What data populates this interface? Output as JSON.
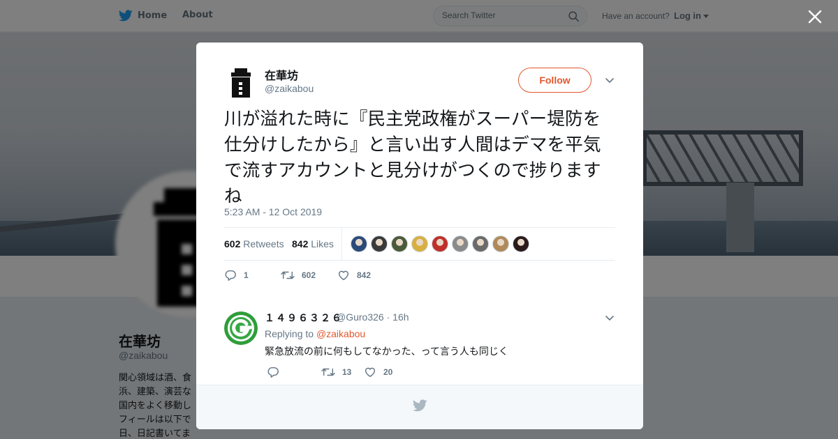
{
  "topbar": {
    "home_label": "Home",
    "about_label": "About",
    "search_placeholder": "Search Twitter",
    "account_prompt": "Have an account?",
    "login_label": "Log in"
  },
  "profile": {
    "name": "在華坊",
    "handle": "@zaikabou",
    "bio_lines": [
      "関心領域は酒、食",
      "浜、建築、演芸な",
      "国内をよく移動し",
      "フィールは以下で",
      "日、日記書いてま"
    ]
  },
  "tweet": {
    "author_name": "在華坊",
    "author_handle": "@zaikabou",
    "follow_label": "Follow",
    "text": "川が溢れた時に『民主党政権がスーパー堤防を仕分けしたから』と言い出す人間はデマを平気で流すアカウントと見分けがつくので捗りますね",
    "timestamp": "5:23 AM - 12 Oct 2019",
    "retweets": "602",
    "retweets_label": "Retweets",
    "likes": "842",
    "likes_label": "Likes",
    "reply_count": "1",
    "retweet_count": "602",
    "like_count": "842",
    "liker_colors": [
      "#2b4a7a",
      "#3a3a3a",
      "#4a5a3a",
      "#d8b040",
      "#c0302a",
      "#8a8a8a",
      "#6a6a6a",
      "#b08a5a",
      "#2a1a1a"
    ]
  },
  "reply": {
    "name": "１４９６３２６",
    "handle": "@Guro326",
    "age": "16h",
    "replying_prefix": "Replying to",
    "replying_to": "@zaikabou",
    "text": "緊急放流の前に何もしてなかった、って言う人も同じく",
    "reply_count": "",
    "retweet_count": "13",
    "like_count": "20"
  },
  "colors": {
    "accent": "#e0572c",
    "twitter_blue": "#1da1f2",
    "muted": "#657786"
  }
}
